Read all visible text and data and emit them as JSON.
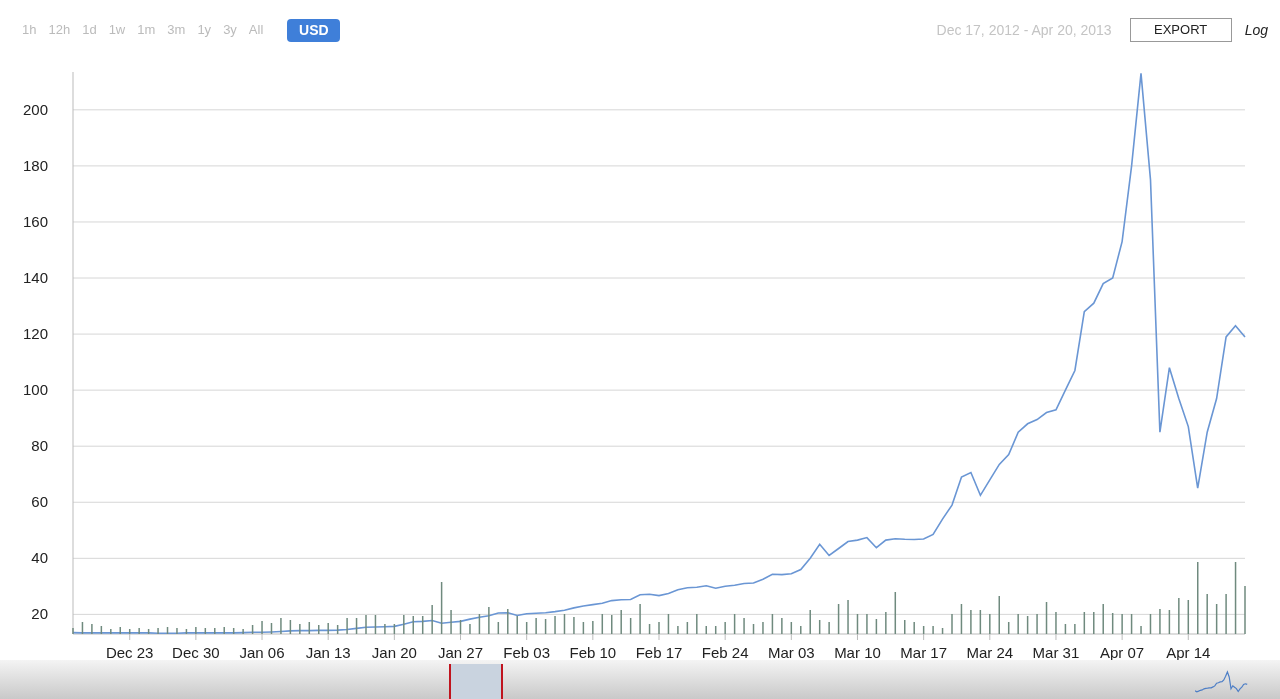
{
  "ranges": [
    {
      "label": "1h",
      "selected": false
    },
    {
      "label": "12h",
      "selected": false
    },
    {
      "label": "1d",
      "selected": false
    },
    {
      "label": "1w",
      "selected": false
    },
    {
      "label": "1m",
      "selected": false
    },
    {
      "label": "3m",
      "selected": false
    },
    {
      "label": "1y",
      "selected": false
    },
    {
      "label": "3y",
      "selected": false
    },
    {
      "label": "All",
      "selected": false
    }
  ],
  "currencies": [
    {
      "label": "USD",
      "selected": true
    }
  ],
  "date_range": "Dec 17, 2012 - Apr 20, 2013",
  "export_button": "EXPORT",
  "log_toggle": "Log",
  "chart_data": {
    "type": "line",
    "grid": true,
    "categories": [
      null,
      null,
      null,
      null,
      null,
      null,
      "Dec 23",
      null,
      null,
      null,
      null,
      null,
      null,
      "Dec 30",
      null,
      null,
      null,
      null,
      null,
      null,
      "Jan 06",
      null,
      null,
      null,
      null,
      null,
      null,
      "Jan 13",
      null,
      null,
      null,
      null,
      null,
      null,
      "Jan 20",
      null,
      null,
      null,
      null,
      null,
      null,
      "Jan 27",
      null,
      null,
      null,
      null,
      null,
      null,
      "Feb 03",
      null,
      null,
      null,
      null,
      null,
      null,
      "Feb 10",
      null,
      null,
      null,
      null,
      null,
      null,
      "Feb 17",
      null,
      null,
      null,
      null,
      null,
      null,
      "Feb 24",
      null,
      null,
      null,
      null,
      null,
      null,
      "Mar 03",
      null,
      null,
      null,
      null,
      null,
      null,
      "Mar 10",
      null,
      null,
      null,
      null,
      null,
      null,
      "Mar 17",
      null,
      null,
      null,
      null,
      null,
      null,
      "Mar 24",
      null,
      null,
      null,
      null,
      null,
      null,
      "Mar 31",
      null,
      null,
      null,
      null,
      null,
      null,
      "Apr 07",
      null,
      null,
      null,
      null,
      null,
      null,
      "Apr 14",
      null,
      null,
      null,
      null,
      null,
      null
    ],
    "ylim": [
      13,
      213.5
    ],
    "yticks": [
      20,
      40,
      60,
      80,
      100,
      120,
      140,
      160,
      180,
      200
    ],
    "series": [
      {
        "color": "#6a96d4",
        "values": [
          13.5,
          13.4,
          13.4,
          13.4,
          13.4,
          13.4,
          13.4,
          13.4,
          13.4,
          13.3,
          13.3,
          13.3,
          13.4,
          13.4,
          13.4,
          13.4,
          13.4,
          13.4,
          13.5,
          13.6,
          13.6,
          13.7,
          13.9,
          14.1,
          14.2,
          14.2,
          14.3,
          14.3,
          14.4,
          14.6,
          15.0,
          15.4,
          15.5,
          15.6,
          15.7,
          16.5,
          17.4,
          17.5,
          17.8,
          16.8,
          17.2,
          17.5,
          18.3,
          19.0,
          19.5,
          20.5,
          20.6,
          19.6,
          20.2,
          20.4,
          20.6,
          21.0,
          21.5,
          22.3,
          23.0,
          23.5,
          24.0,
          24.9,
          25.2,
          25.3,
          27.0,
          27.2,
          26.7,
          27.4,
          28.8,
          29.5,
          29.7,
          30.2,
          29.3,
          30.0,
          30.4,
          31.0,
          31.2,
          32.5,
          34.3,
          34.2,
          34.5,
          36,
          40,
          45,
          41,
          43.5,
          46,
          46.5,
          47.4,
          43.8,
          46.5,
          47,
          46.8,
          46.7,
          46.9,
          48.5,
          54,
          59,
          69,
          70.6,
          62.5,
          68,
          73.5,
          77,
          85,
          88,
          89.5,
          92,
          93,
          100,
          107,
          128,
          131,
          138,
          140,
          153,
          180,
          213,
          175,
          85,
          108,
          97,
          87,
          65,
          85,
          97,
          119,
          123,
          119
        ]
      }
    ]
  }
}
